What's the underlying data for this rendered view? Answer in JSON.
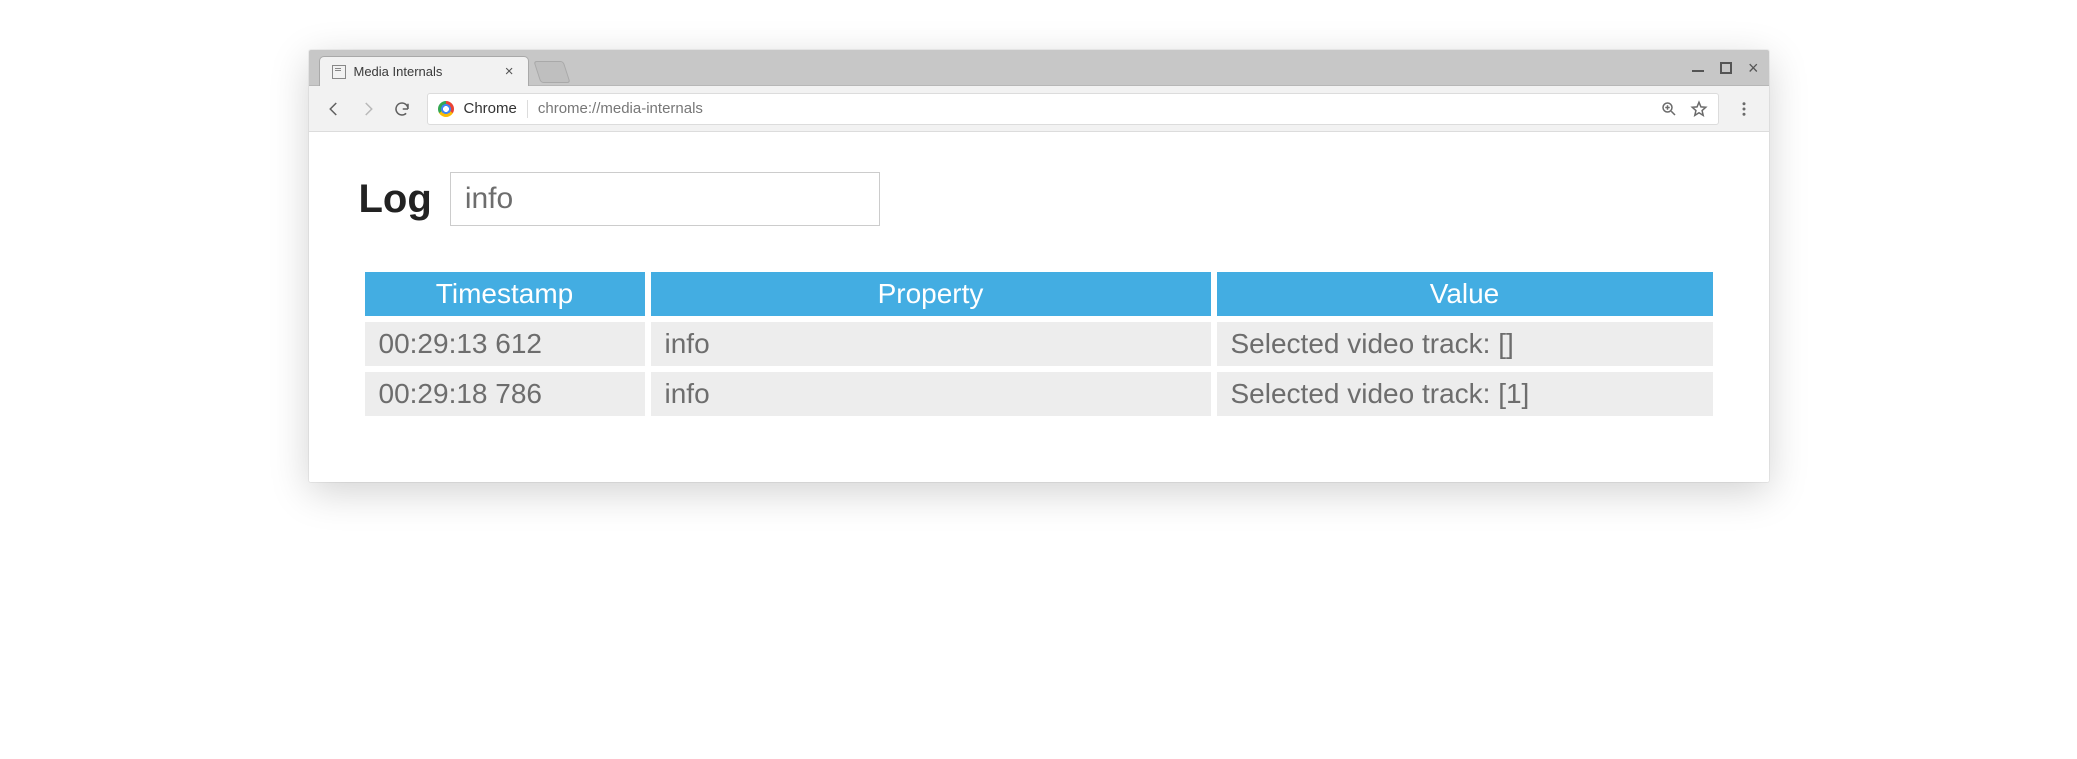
{
  "browser": {
    "tab_title": "Media Internals",
    "origin_label": "Chrome",
    "url": "chrome://media-internals"
  },
  "page": {
    "heading": "Log",
    "filter_value": "info",
    "columns": {
      "timestamp": "Timestamp",
      "property": "Property",
      "value": "Value"
    },
    "rows": [
      {
        "timestamp": "00:29:13 612",
        "property": "info",
        "value": "Selected video track: []"
      },
      {
        "timestamp": "00:29:18 786",
        "property": "info",
        "value": "Selected video track: [1]"
      }
    ]
  }
}
